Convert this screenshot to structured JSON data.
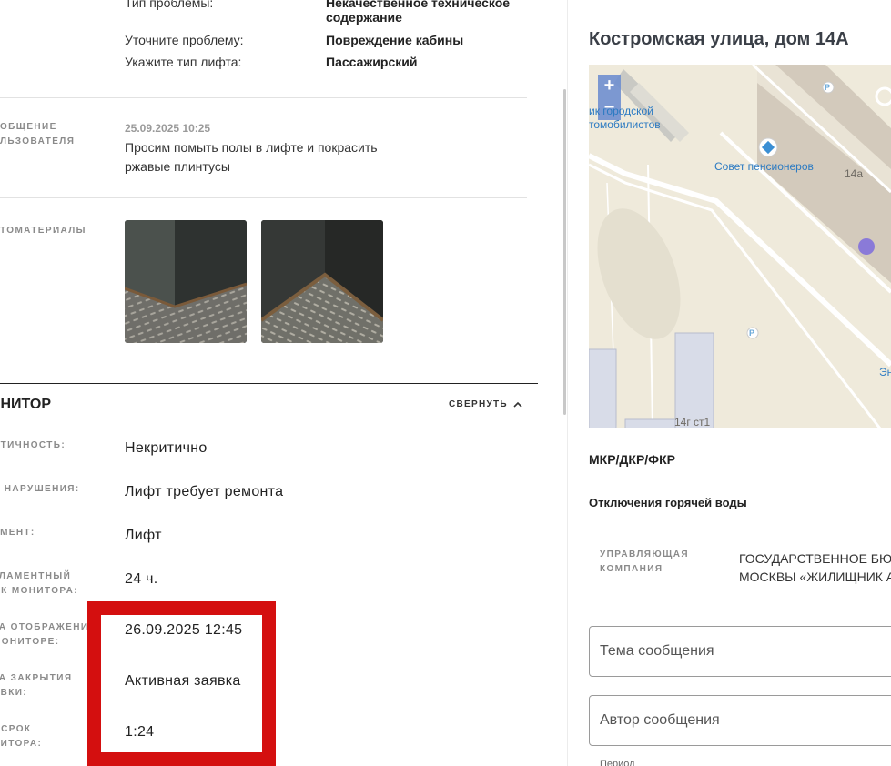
{
  "problem": {
    "type_label": "Тип проблемы:",
    "type_value": "Некачественное техническое содержание",
    "specify_label": "Уточните проблему:",
    "specify_value": "Повреждение кабины",
    "lift_label": "Укажите тип лифта:",
    "lift_value": "Пассажирский"
  },
  "message": {
    "label_line1": "ОБЩЕНИЕ",
    "label_line2": "ЛЬЗОВАТЕЛЯ",
    "date": "25.09.2025 10:25",
    "text": "Просим помыть полы в лифте и покрасить ржавые плинтусы"
  },
  "photos": {
    "label": "ТОМАТЕРИАЛЫ"
  },
  "monitor": {
    "title": "ОНИТОР",
    "collapse_label": "СВЕРНУТЬ",
    "rows": [
      {
        "label1": "ИТИЧНОСТЬ:",
        "label2": "",
        "value": "Некритично"
      },
      {
        "label1": "П НАРУШЕНИЯ:",
        "label2": "",
        "value": "Лифт требует ремонта"
      },
      {
        "label1": "ЕМЕНТ:",
        "label2": "",
        "value": "Лифт"
      },
      {
        "label1": "ГЛАМЕНТНЫЙ",
        "label2": "ОК МОНИТОРА:",
        "value": "24 ч."
      },
      {
        "label1": "ТА ОТОБРАЖЕНИ",
        "label2": "МОНИТОРЕ:",
        "value": "26.09.2025 12:45"
      },
      {
        "label1": "ТА ЗАКРЫТИЯ",
        "label2": "ЯВКИ:",
        "value": "Активная заявка"
      },
      {
        "label1": "ОСРОК",
        "label2": "НИТОРА:",
        "value": "1:24"
      }
    ]
  },
  "right": {
    "address": "Костромская улица, дом 14А",
    "map": {
      "zoom_in": "+",
      "zoom_out": "−",
      "labels": {
        "poi1_line1": "ик городской",
        "poi1_line2": "томобилистов",
        "poi2": "Совет пенсионеров",
        "house1": "14а",
        "house2": "14г ст1",
        "parking": "P",
        "edge": "Эн"
      }
    },
    "program_label": "МКР/ДКР/ФКР",
    "outage_label": "Отключения горячей воды",
    "uk_label_line1": "УПРАВЛЯЮЩАЯ",
    "uk_label_line2": "КОМПАНИЯ",
    "uk_value_line1": "ГОСУДАРСТВЕННОЕ БЮДЖ",
    "uk_value_line2": "МОСКВЫ «ЖИЛИЩНИК АЛ",
    "subject_placeholder": "Тема сообщения",
    "author_placeholder": "Автор сообщения",
    "cut_text": "Период"
  },
  "colors": {
    "highlight": "#d40f0f",
    "map_bg": "#efeadb",
    "map_poi": "#3b8fd4",
    "map_marker": "#8a7ad8"
  }
}
